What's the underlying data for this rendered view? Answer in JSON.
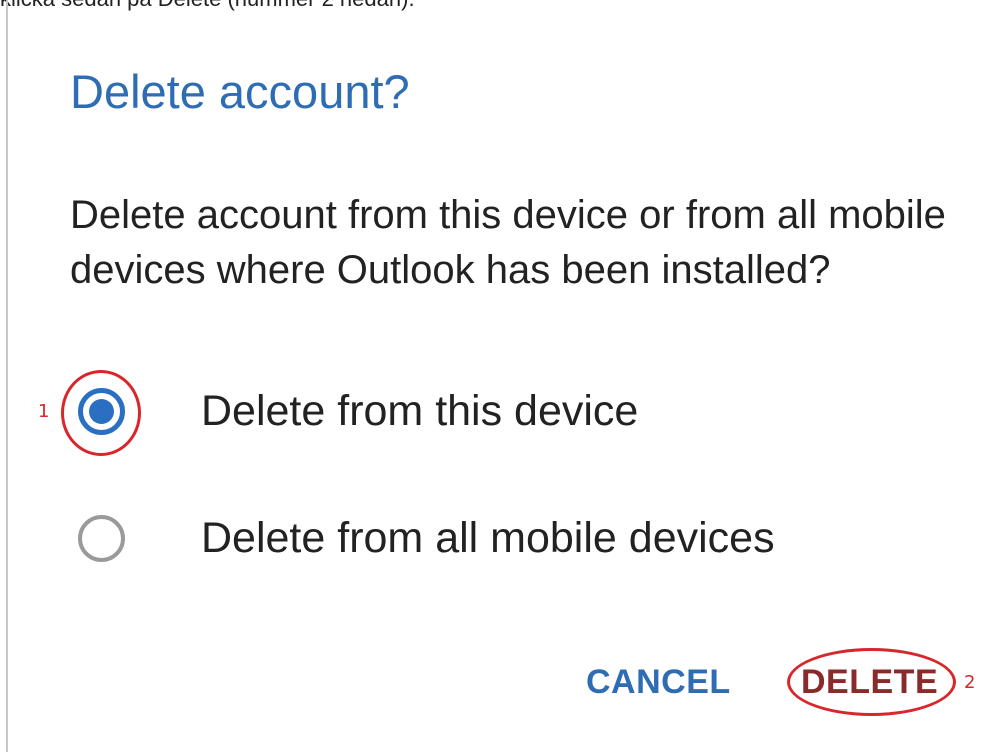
{
  "caption": "klicka sedan på Delete (nummer 2 nedan).",
  "dialog": {
    "title": "Delete account?",
    "message": "Delete account from this device or from all mobile devices where Outlook has been installed?",
    "options": [
      {
        "label": "Delete from this device",
        "selected": true
      },
      {
        "label": "Delete from all mobile devices",
        "selected": false
      }
    ],
    "cancel_label": "CANCEL",
    "delete_label": "DELETE"
  },
  "annotations": {
    "marker_1": "1",
    "marker_2": "2",
    "color": "#d8262b"
  },
  "colors": {
    "accent": "#2e6db4",
    "radio": "#2b6fc2",
    "delete_text": "#8a2a2a"
  }
}
